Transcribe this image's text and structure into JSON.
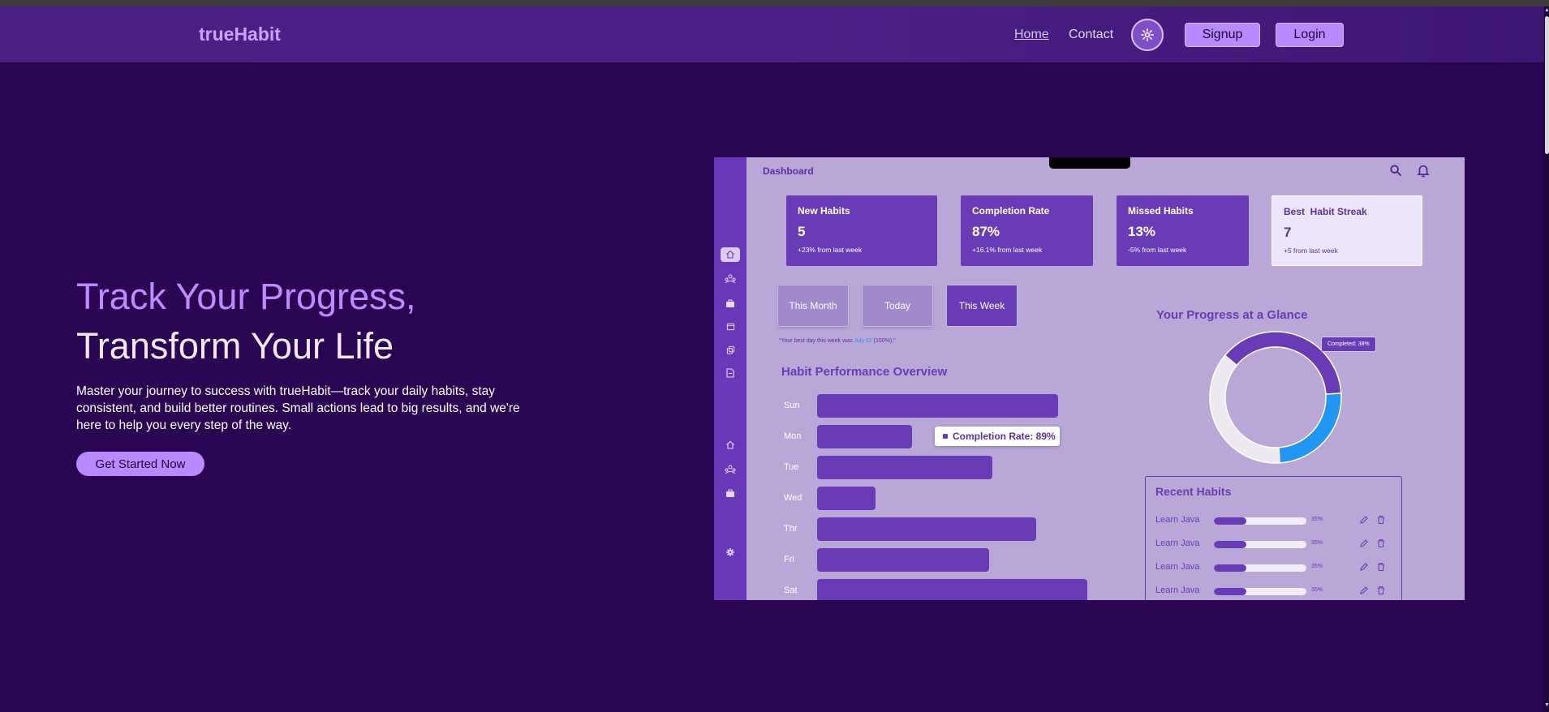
{
  "navbar": {
    "brand": "trueHabit",
    "links": {
      "home": "Home",
      "contact": "Contact"
    },
    "signup": "Signup",
    "login": "Login"
  },
  "hero": {
    "title_line1": "Track Your Progress,",
    "title_line2": "Transform Your Life",
    "description": "Master your journey to success with trueHabit—track your daily habits, stay consistent, and build better routines. Small actions lead to big results, and we're here to help you every step of the way.",
    "cta": "Get Started Now"
  },
  "dashboard": {
    "title": "Dashboard",
    "stats": [
      {
        "title": "New Habits",
        "value": "5",
        "sub": "+23% from last week"
      },
      {
        "title": "Completion Rate",
        "value": "87%",
        "sub": "+16.1% from last week"
      },
      {
        "title": "Missed Habits",
        "value": "13%",
        "sub": "-5% from last week"
      },
      {
        "title": "Best  Habit Streak",
        "value": "7",
        "sub": "+5 from last week"
      }
    ],
    "ranges": {
      "month": "This Month",
      "today": "Today",
      "week": "This Week"
    },
    "best_day": {
      "prefix": "\"Your best day this week was ",
      "day": "July 12",
      "suffix": " (100%).\""
    },
    "performance": {
      "title": "Habit Performance Overview",
      "days": [
        {
          "label": "Sun",
          "value": 0.66
        },
        {
          "label": "Mon",
          "value": 0.26
        },
        {
          "label": "Tue",
          "value": 0.48
        },
        {
          "label": "Wed",
          "value": 0.16
        },
        {
          "label": "Thr",
          "value": 0.6
        },
        {
          "label": "Fri",
          "value": 0.47
        },
        {
          "label": "Sat",
          "value": 0.74
        }
      ],
      "tooltip": "Completion Rate: 89%"
    },
    "glance": {
      "title": "Your Progress at a Glance",
      "badge": "Completed: 38%",
      "segments": [
        {
          "name": "purple",
          "value": 38,
          "color": "#6a3bb7"
        },
        {
          "name": "blue",
          "value": 25,
          "color": "#2196f3"
        },
        {
          "name": "white",
          "value": 37,
          "color": "#ece9f1"
        }
      ]
    },
    "recent": {
      "title": "Recent Habits",
      "items": [
        {
          "name": "Learn Java",
          "pct": "35%",
          "progress": 0.35
        },
        {
          "name": "Learn Java",
          "pct": "35%",
          "progress": 0.35
        },
        {
          "name": "Learn Java",
          "pct": "35%",
          "progress": 0.35
        },
        {
          "name": "Learn Java",
          "pct": "35%",
          "progress": 0.35
        }
      ]
    }
  },
  "colors": {
    "accent": "#b98aff",
    "background": "#2a0552",
    "dashboard_primary": "#6a3bb7"
  },
  "icons": [
    "gear-icon",
    "search-icon",
    "bell-icon",
    "home-icon",
    "users-icon",
    "briefcase-icon",
    "calendar-icon",
    "copy-icon",
    "document-icon",
    "settings-icon",
    "edit-icon",
    "trash-icon"
  ]
}
